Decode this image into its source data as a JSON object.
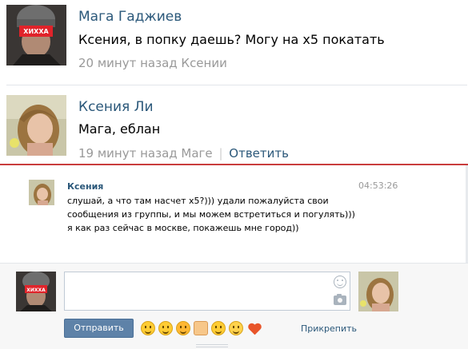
{
  "comments": [
    {
      "author": "Мага Гаджиев",
      "avatar_badge": "ХИХХА",
      "text": "Ксения, в попку даешь? Могу на х5 покатать",
      "meta": "20 минут назад Ксении"
    },
    {
      "author": "Ксения Ли",
      "text": "Мага, еблан",
      "meta": "19 минут назад Маге",
      "separator": "|",
      "reply_label": "Ответить"
    }
  ],
  "chat": {
    "message": {
      "author": "Ксения",
      "time": "04:53:26",
      "text": "слушай, а что там насчет х5?))) удали пожалуйста свои сообщения из группы, и мы можем встретиться и погулять))) я как раз сейчас в москве, покажешь мне город))"
    },
    "composer": {
      "me_avatar_badge": "ХИХХА",
      "input_value": "",
      "send_label": "Отправить",
      "attach_label": "Прикрепить",
      "emojis": [
        "smile-emoji",
        "laugh-emoji",
        "angry-emoji",
        "thumbs-up-emoji",
        "tired-emoji",
        "crying-emoji",
        "heart-emoji"
      ]
    }
  },
  "colors": {
    "link": "#2b587a",
    "meta": "#999999",
    "divider_red": "#c93c3c",
    "send_button": "#5e82a8"
  }
}
